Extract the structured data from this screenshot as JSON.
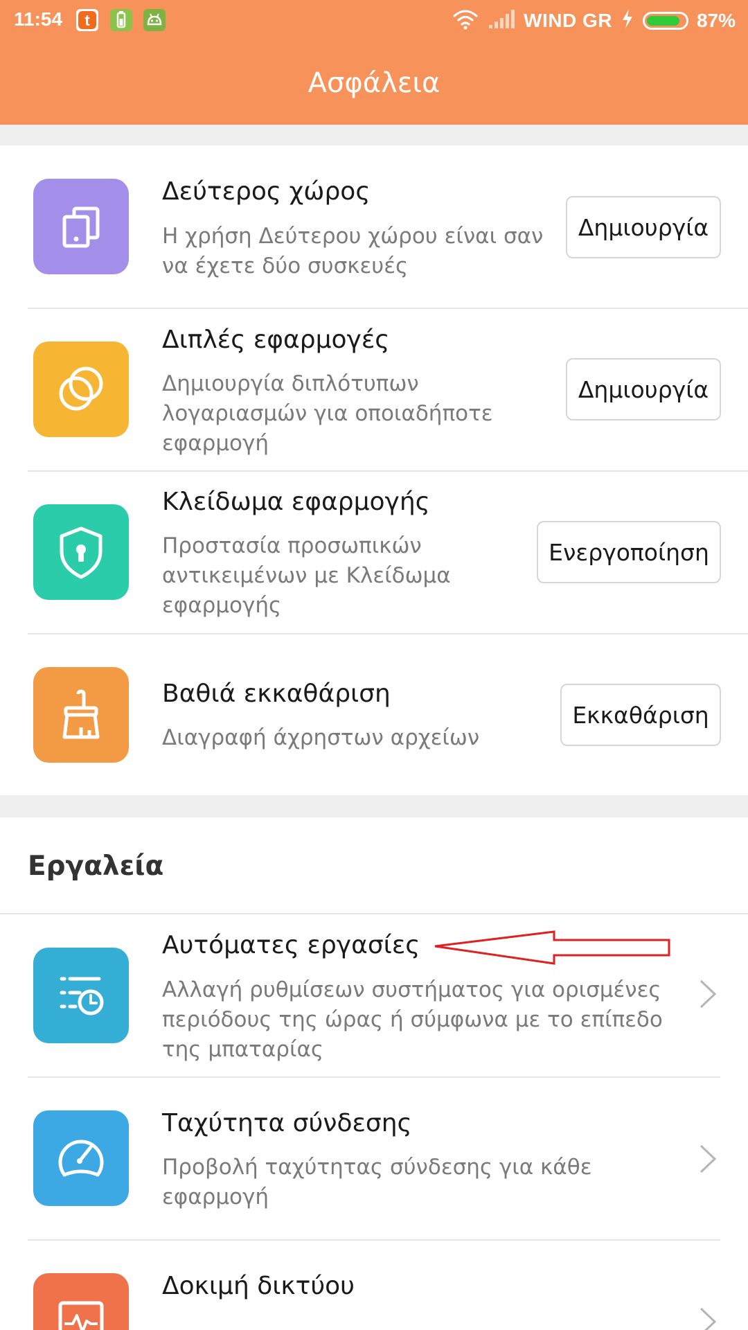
{
  "status_bar": {
    "time": "11:54",
    "carrier": "WIND GR",
    "battery": "87%",
    "battery_level": 0.87,
    "notification_icons": [
      "app-notification-icon",
      "battery-app-icon",
      "android-app-icon"
    ]
  },
  "header": {
    "title": "Ασφάλεια"
  },
  "colors": {
    "header_background": "#F7935A",
    "second_space_tile": "#A38FE9",
    "dual_apps_tile": "#F6B532",
    "app_lock_tile": "#2BCCAA",
    "deep_clean_tile": "#F39A45",
    "automation_tile": "#35AED6",
    "network_speed_tile": "#3CA8E4",
    "network_test_tile": "#F0724A",
    "annotation_arrow": "#E02020"
  },
  "feature_items": [
    {
      "icon": "second-space-icon",
      "title": "Δεύτερος χώρος",
      "desc_line1": "Η χρήση Δεύτερου χώρου είναι σαν",
      "desc_line2": "να έχετε δύο συσκευές",
      "button": "Δημιουργία"
    },
    {
      "icon": "dual-apps-icon",
      "title": "Διπλές εφαρμογές",
      "desc_line1": "Δημιουργία διπλότυπων",
      "desc_line2": "λογαριασμών για οποιαδήποτε",
      "desc_line3": "εφαρμογή",
      "button": "Δημιουργία"
    },
    {
      "icon": "shield-lock-icon",
      "title": "Κλείδωμα εφαρμογής",
      "desc_line1": "Προστασία προσωπικών",
      "desc_line2": "αντικειμένων με Κλείδωμα",
      "desc_line3": "εφαρμογής",
      "button": "Ενεργοποίηση"
    },
    {
      "icon": "broom-icon",
      "title": "Βαθιά εκκαθάριση",
      "desc_line1": "Διαγραφή άχρηστων αρχείων",
      "button": "Εκκαθάριση"
    }
  ],
  "tools_section": {
    "title": "Εργαλεία",
    "items": [
      {
        "icon": "scheduled-tasks-icon",
        "title": "Αυτόματες εργασίες",
        "desc_line1": "Αλλαγή ρυθμίσεων συστήματος για ορισμένες",
        "desc_line2": "περιόδους της ώρας ή σύμφωνα με το επίπεδο",
        "desc_line3": "της μπαταρίας"
      },
      {
        "icon": "speedometer-icon",
        "title": "Ταχύτητα σύνδεσης",
        "desc_line1": "Προβολή ταχύτητας σύνδεσης για κάθε",
        "desc_line2": "εφαρμογή"
      },
      {
        "icon": "network-test-icon",
        "title": "Δοκιμή δικτύου"
      }
    ]
  }
}
